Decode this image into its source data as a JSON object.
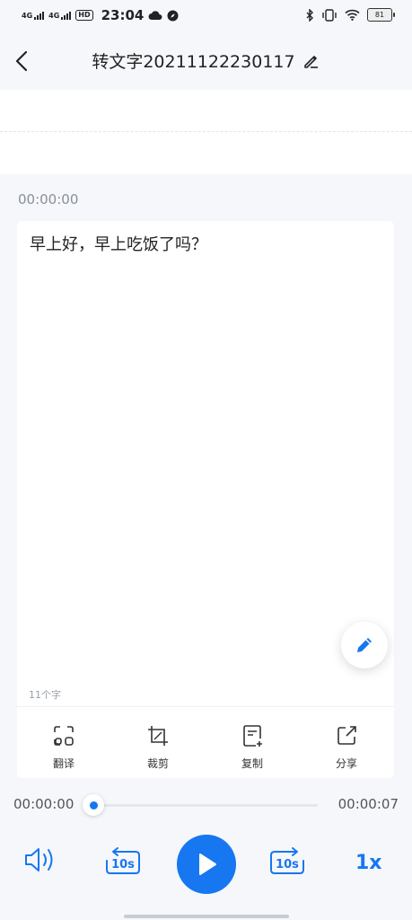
{
  "status_bar": {
    "network1": "4G",
    "network2": "4G",
    "hd": "HD",
    "time": "23:04",
    "battery": "81"
  },
  "header": {
    "title": "转文字20211122230117"
  },
  "transcript": {
    "segment_time": "00:00:00",
    "text": "早上好，早上吃饭了吗？",
    "char_count": "11个字"
  },
  "toolbar": {
    "items": [
      {
        "label": "翻译",
        "icon": "translate-icon"
      },
      {
        "label": "裁剪",
        "icon": "crop-icon"
      },
      {
        "label": "复制",
        "icon": "copy-icon"
      },
      {
        "label": "分享",
        "icon": "share-icon"
      }
    ]
  },
  "player": {
    "current_time": "00:00:00",
    "total_time": "00:00:07",
    "progress": 0,
    "rewind_label": "10s",
    "forward_label": "10s",
    "speed": "1x"
  },
  "colors": {
    "accent": "#1677f0",
    "background": "#f5f7fb"
  }
}
